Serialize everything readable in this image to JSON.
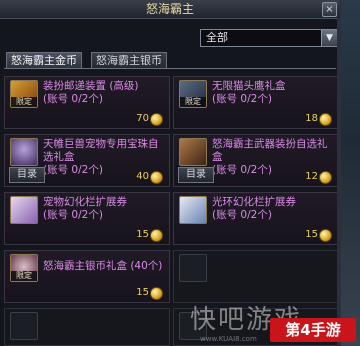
{
  "window": {
    "title": "怒海霸主",
    "close_label": "×"
  },
  "filter": {
    "selected": "全部",
    "arrow": "▼"
  },
  "tabs": [
    {
      "label": "怒海霸主金币",
      "active": true
    },
    {
      "label": "怒海霸主银币",
      "active": false
    }
  ],
  "items": [
    {
      "name": "装扮邮递装置 (高级)",
      "account": "(账号 0/2个)",
      "price": "70",
      "badge": "限定",
      "has_catalog": false
    },
    {
      "name": "无限猫头鹰礼盒",
      "account": "(账号 0/2个)",
      "price": "18",
      "badge": "限定",
      "has_catalog": false
    },
    {
      "name": "天帷巨兽宠物专用宝珠自选礼盒",
      "account": "(账号 0/2个)",
      "price": "40",
      "badge": "",
      "has_catalog": true
    },
    {
      "name": "怒海霸主武器装扮自选礼盒",
      "account": "(账号 0/2个)",
      "price": "12",
      "badge": "",
      "has_catalog": true
    },
    {
      "name": "宠物幻化栏扩展券",
      "account": "(账号 0/2个)",
      "price": "15",
      "badge": "",
      "has_catalog": false
    },
    {
      "name": "光环幻化栏扩展券",
      "account": "(账号 0/2个)",
      "price": "15",
      "badge": "",
      "has_catalog": false
    },
    {
      "name": "怒海霸主银币礼盒 (40个)",
      "account": "",
      "price": "15",
      "badge": "限定",
      "has_catalog": false
    }
  ],
  "catalog_label": "目录",
  "watermark": {
    "text": "快吧游戏",
    "logo": "第4手游",
    "url": "www.KUAI8.com"
  },
  "colors": {
    "item_name": "#d98be6",
    "price": "#e6cf6a",
    "title": "#e8d9a8"
  }
}
